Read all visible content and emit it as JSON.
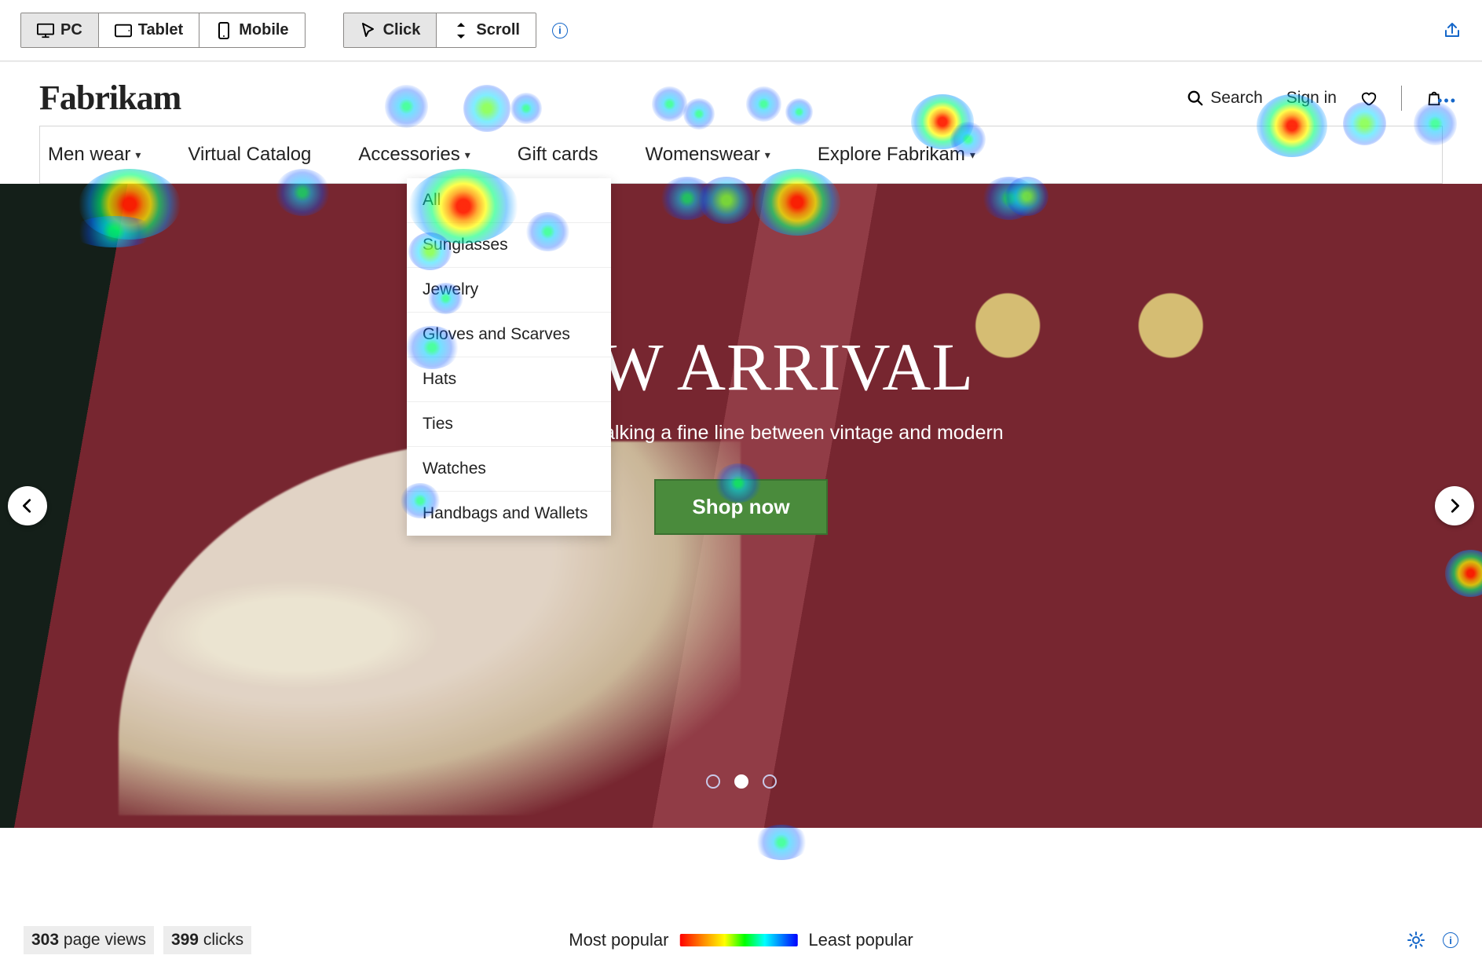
{
  "toolbar": {
    "devices": [
      "PC",
      "Tablet",
      "Mobile"
    ],
    "active_device": "PC",
    "modes": [
      "Click",
      "Scroll"
    ],
    "active_mode": "Click"
  },
  "site": {
    "brand": "Fabrikam",
    "search_label": "Search",
    "signin_label": "Sign in",
    "nav": [
      {
        "label": "Men wear",
        "chevron": true
      },
      {
        "label": "Virtual Catalog",
        "chevron": false
      },
      {
        "label": "Accessories",
        "chevron": true
      },
      {
        "label": "Gift cards",
        "chevron": false
      },
      {
        "label": "Womenswear",
        "chevron": true
      },
      {
        "label": "Explore Fabrikam",
        "chevron": true
      }
    ],
    "accessories_menu": [
      "All",
      "Sunglasses",
      "Jewelry",
      "Gloves and Scarves",
      "Hats",
      "Ties",
      "Watches",
      "Handbags and Wallets"
    ],
    "hero": {
      "title": "NEW ARRIVAL",
      "subtitle": "Accessories walking a fine line between vintage and modern",
      "cta": "Shop now"
    }
  },
  "status": {
    "page_views": {
      "value": "303",
      "label": "page views"
    },
    "clicks": {
      "value": "399",
      "label": "clicks"
    },
    "legend_left": "Most popular",
    "legend_right": "Least popular"
  }
}
